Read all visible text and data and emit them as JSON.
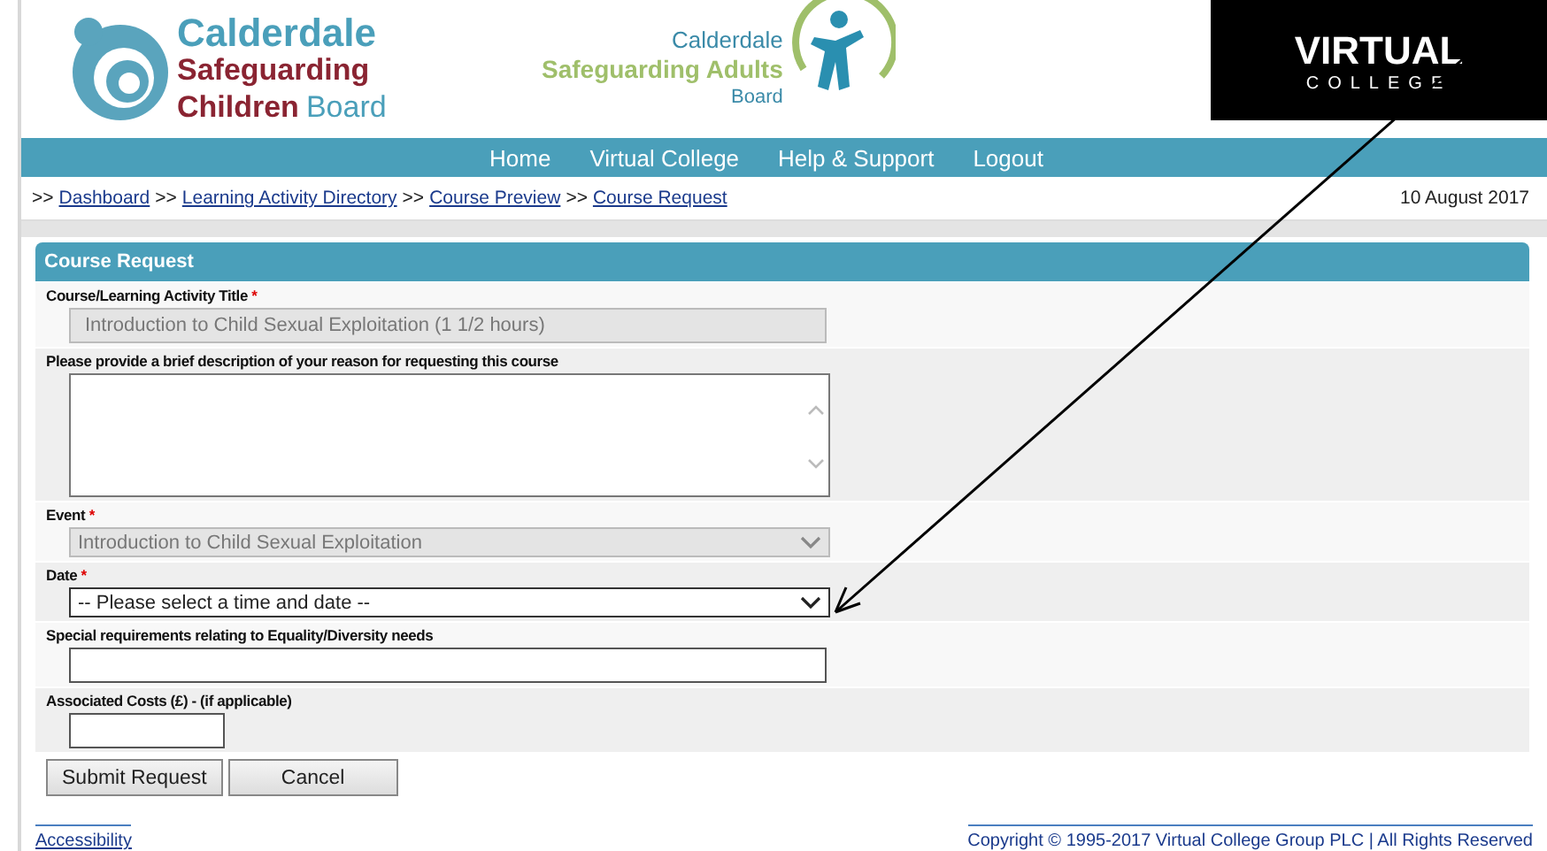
{
  "logos": {
    "children_board": {
      "line_1": "Calderdale",
      "line_2": "Safeguarding",
      "line_3a": "Children",
      "line_3b": "Board"
    },
    "adults_board": {
      "line_1": "Calderdale",
      "line_2": "Safeguarding Adults",
      "line_3": "Board"
    },
    "virtual_college": {
      "line_1": "VIRTUAL",
      "line_2": "COLLEGE"
    }
  },
  "nav": [
    "Home",
    "Virtual College",
    "Help & Support",
    "Logout"
  ],
  "breadcrumb": {
    "separator": ">>",
    "items": [
      "Dashboard",
      "Learning Activity Directory",
      "Course Preview",
      "Course Request"
    ]
  },
  "date": "10 August 2017",
  "form": {
    "title": "Course Request",
    "fields": [
      {
        "kind": "text",
        "label": "Course/Learning Activity Title",
        "required_mark": "*",
        "value": "Introduction to Child Sexual Exploitation (1 1/2 hours)",
        "disabled": true
      },
      {
        "kind": "textarea",
        "label": "Please provide a brief description of your reason for requesting this course"
      },
      {
        "kind": "select",
        "label": "Event",
        "required_mark": "*",
        "value": "Introduction to Child Sexual Exploitation",
        "disabled": true
      },
      {
        "kind": "select",
        "label": "Date",
        "required_mark": "*",
        "value": "-- Please select a time and date --",
        "disabled": false
      },
      {
        "kind": "text",
        "label": "Special requirements relating to Equality/Diversity needs",
        "disabled": false
      },
      {
        "kind": "short_text",
        "label": "Associated Costs (£) - (if applicable)",
        "disabled": false
      }
    ],
    "buttons": [
      "Submit Request",
      "Cancel"
    ]
  },
  "footer": {
    "link": "Accessibility",
    "copyright": "Copyright © 1995-2017 Virtual College Group PLC | All Rights Reserved"
  }
}
